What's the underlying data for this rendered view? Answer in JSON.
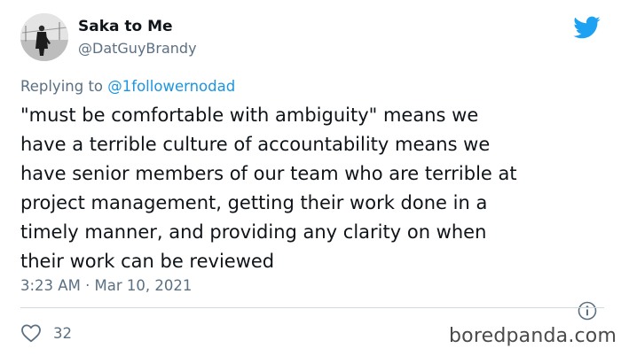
{
  "user": {
    "display_name": "Saka to Me",
    "handle": "@DatGuyBrandy",
    "avatar": "person-in-coat-photo"
  },
  "reply": {
    "prefix": "Replying to",
    "target": "@1followernodad"
  },
  "tweet": {
    "lines": [
      "\"must be comfortable with ambiguity\" means we",
      "have a terrible culture of accountability means we",
      "have senior members of our team who are terrible at",
      "project management, getting their work done in a",
      "timely manner, and providing any clarity on when",
      "their work can be reviewed"
    ],
    "timestamp": "3:23 AM · Mar 10, 2021"
  },
  "engagement": {
    "likes": "32"
  },
  "icons": {
    "brand": "twitter-bird-icon",
    "info": "info-icon",
    "like": "heart-icon"
  },
  "colors": {
    "brand_blue": "#1da1f2",
    "link_blue": "#1b95e0",
    "secondary_text": "#5b7083",
    "primary_text": "#0f1419"
  },
  "watermark": "boredpanda.com"
}
